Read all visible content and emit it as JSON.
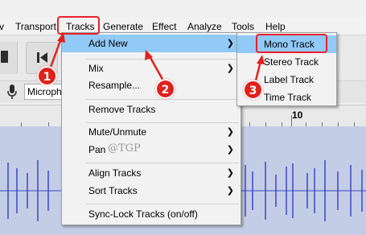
{
  "menubar": {
    "items": [
      "v",
      "Transport",
      "Tracks",
      "Generate",
      "Effect",
      "Analyze",
      "Tools",
      "Help"
    ]
  },
  "device": {
    "mic_value": "Microph"
  },
  "ruler": {
    "label": "10"
  },
  "tracks_menu": {
    "items": [
      {
        "label": "Add New",
        "submenu": true,
        "highlighted": true
      },
      {
        "label": "Mix",
        "submenu": true
      },
      {
        "label": "Resample...",
        "submenu": false
      },
      {
        "label": "Remove Tracks",
        "submenu": false
      },
      {
        "label": "Mute/Unmute",
        "submenu": true
      },
      {
        "label": "Pan",
        "submenu": true
      },
      {
        "label": "Align Tracks",
        "submenu": true
      },
      {
        "label": "Sort Tracks",
        "submenu": true
      },
      {
        "label": "Sync-Lock Tracks (on/off)",
        "submenu": false
      }
    ]
  },
  "add_new_submenu": {
    "items": [
      {
        "label": "Mono Track",
        "highlighted": true
      },
      {
        "label": "Stereo Track"
      },
      {
        "label": "Label Track"
      },
      {
        "label": "Time Track"
      }
    ]
  },
  "annotations": {
    "badges": [
      "1",
      "2",
      "3"
    ],
    "color": "#e0211b"
  },
  "watermark": "@TGP",
  "icons": {
    "stop": "stop-icon",
    "skip_start": "skip-to-start-icon",
    "mic": "microphone-icon",
    "submenu_arrow": "chevron-right-icon"
  },
  "colors": {
    "highlight": "#91c9f7",
    "waveform": "#3b46c6",
    "track_bg": "#c4cde6"
  }
}
